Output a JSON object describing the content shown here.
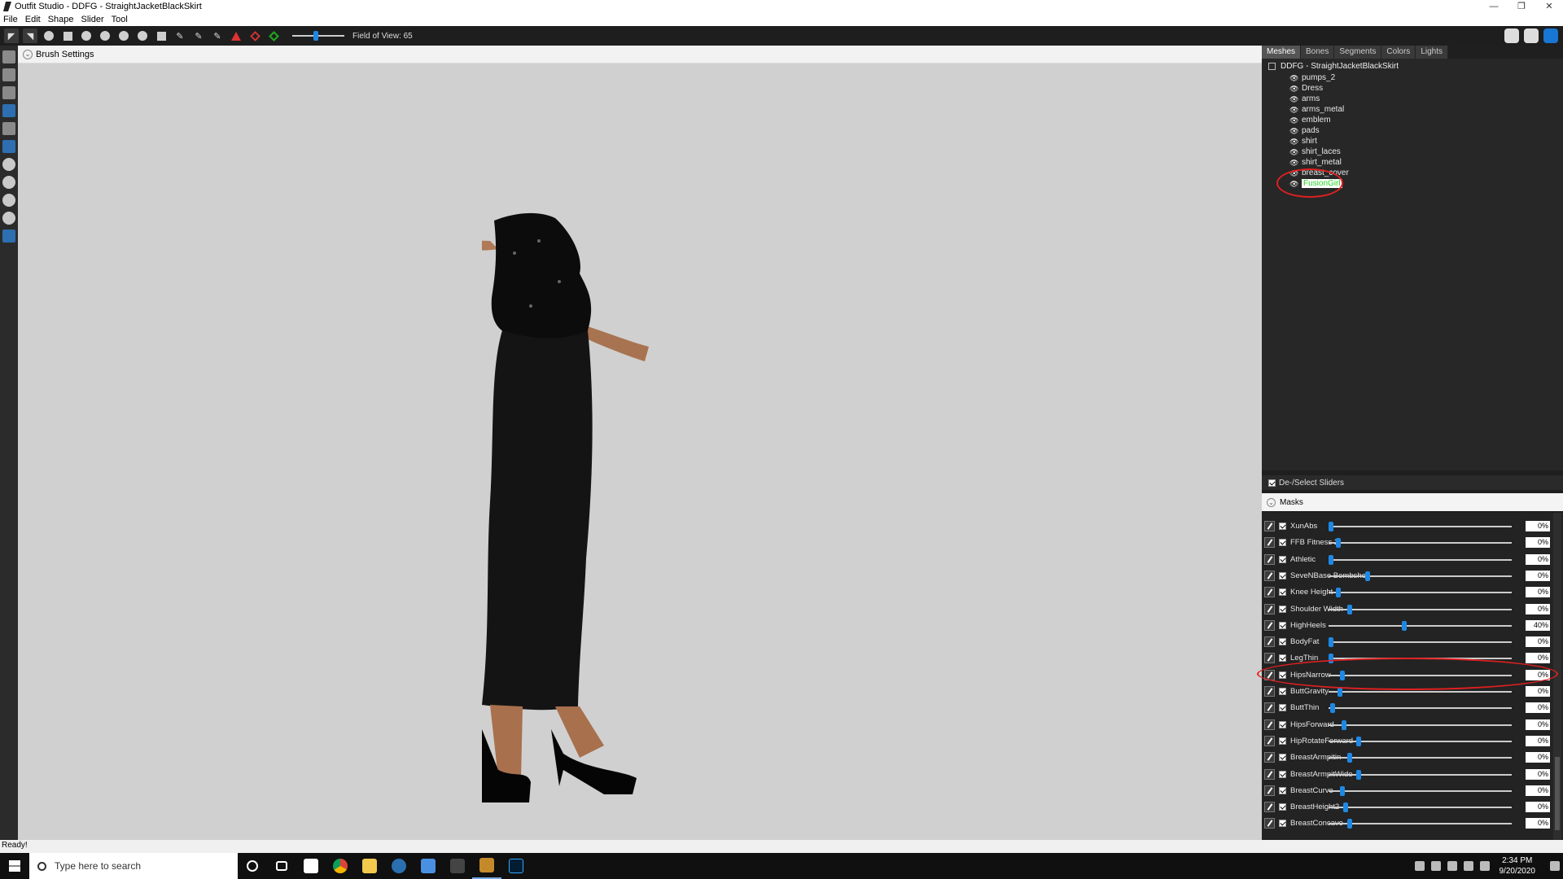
{
  "window": {
    "title": "Outfit Studio - DDFG - StraightJacketBlackSkirt",
    "controls": [
      "—",
      "❐",
      "✕"
    ]
  },
  "menu": [
    "File",
    "Edit",
    "Shape",
    "Slider",
    "Tool"
  ],
  "toolbar": {
    "fov_label": "Field of View: 65",
    "fov_value": 65
  },
  "brush_settings": {
    "label": "Brush Settings"
  },
  "panel_tabs": [
    "Meshes",
    "Bones",
    "Segments",
    "Colors",
    "Lights"
  ],
  "mesh_tree": {
    "root": "DDFG - StraightJacketBlackSkirt",
    "items": [
      "pumps_2",
      "Dress",
      "arms",
      "arms_metal",
      "emblem",
      "pads",
      "shirt",
      "shirt_laces",
      "shirt_metal",
      "breast_cover",
      "FusionGirl"
    ],
    "selected": "FusionGirl"
  },
  "sliders_panel": {
    "deselect_label": "De-/Select Sliders",
    "masks_label": "Masks",
    "sliders": [
      {
        "name": "XunAbs",
        "value": "0%",
        "pos": 0.0
      },
      {
        "name": "FFB Fitness 2",
        "value": "0%",
        "pos": 0.04
      },
      {
        "name": "Athletic",
        "value": "0%",
        "pos": 0.0
      },
      {
        "name": "SeveNBase Bombshell",
        "value": "0%",
        "pos": 0.2
      },
      {
        "name": "Knee Height",
        "value": "0%",
        "pos": 0.04
      },
      {
        "name": "Shoulder Width",
        "value": "0%",
        "pos": 0.1
      },
      {
        "name": "HighHeels",
        "value": "40%",
        "pos": 0.4
      },
      {
        "name": "BodyFat",
        "value": "0%",
        "pos": 0.0
      },
      {
        "name": "LegThin",
        "value": "0%",
        "pos": 0.0
      },
      {
        "name": "HipsNarrow",
        "value": "0%",
        "pos": 0.06
      },
      {
        "name": "ButtGravity",
        "value": "0%",
        "pos": 0.05
      },
      {
        "name": "ButtThin",
        "value": "0%",
        "pos": 0.01
      },
      {
        "name": "HipsForward",
        "value": "0%",
        "pos": 0.07
      },
      {
        "name": "HipRotateForward",
        "value": "0%",
        "pos": 0.15
      },
      {
        "name": "BreastArmpitin",
        "value": "0%",
        "pos": 0.1
      },
      {
        "name": "BreastArmpitWide",
        "value": "0%",
        "pos": 0.15
      },
      {
        "name": "BreastCurve",
        "value": "0%",
        "pos": 0.06
      },
      {
        "name": "BreastHeight2",
        "value": "0%",
        "pos": 0.08
      },
      {
        "name": "BreastConcave",
        "value": "0%",
        "pos": 0.1
      }
    ]
  },
  "status": "Ready!",
  "taskbar": {
    "search_placeholder": "Type here to search",
    "time": "2:34 PM",
    "date": "9/20/2020"
  },
  "colors": {
    "accent": "#1e88e5",
    "highlight": "#e02020"
  }
}
